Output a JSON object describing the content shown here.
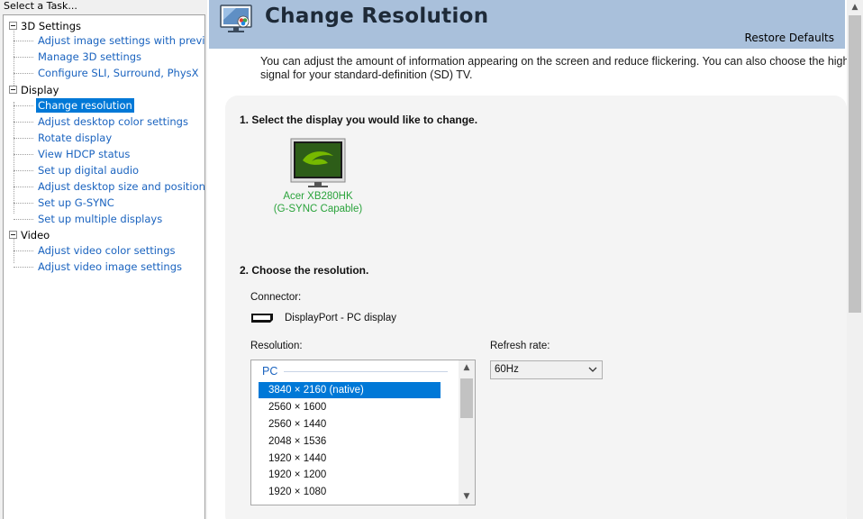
{
  "left_pane": {
    "header": "Select a Task...",
    "groups": [
      {
        "label": "3D Settings",
        "items": [
          "Adjust image settings with preview",
          "Manage 3D settings",
          "Configure SLI, Surround, PhysX"
        ]
      },
      {
        "label": "Display",
        "items": [
          "Change resolution",
          "Adjust desktop color settings",
          "Rotate display",
          "View HDCP status",
          "Set up digital audio",
          "Adjust desktop size and position",
          "Set up G-SYNC",
          "Set up multiple displays"
        ]
      },
      {
        "label": "Video",
        "items": [
          "Adjust video color settings",
          "Adjust video image settings"
        ]
      }
    ],
    "selected_item": "Change resolution"
  },
  "header": {
    "title": "Change Resolution",
    "restore_defaults": "Restore Defaults",
    "banner_color": "#a9c0db"
  },
  "description": {
    "line1": "You can adjust the amount of information appearing on the screen and reduce flickering. You can also choose the high-defin",
    "line2": "signal for your standard-definition (SD) TV."
  },
  "section1": {
    "heading": "1. Select the display you would like to change.",
    "display": {
      "name": "Acer XB280HK",
      "subtitle": "(G-SYNC Capable)",
      "icon": "monitor-icon",
      "name_color": "#2aa33b"
    }
  },
  "section2": {
    "heading": "2. Choose the resolution.",
    "connector_label": "Connector:",
    "connector_value": "DisplayPort - PC display",
    "resolution_label": "Resolution:",
    "resolution_group": "PC",
    "resolutions": [
      "3840 × 2160 (native)",
      "2560 × 1600",
      "2560 × 1440",
      "2048 × 1536",
      "1920 × 1440",
      "1920 × 1200",
      "1920 × 1080"
    ],
    "selected_resolution": "3840 × 2160 (native)",
    "refresh_label": "Refresh rate:",
    "refresh_value": "60Hz"
  },
  "colors": {
    "accent": "#0078d7",
    "link": "#1a63bf",
    "panel_bg": "#f4f4f4"
  }
}
